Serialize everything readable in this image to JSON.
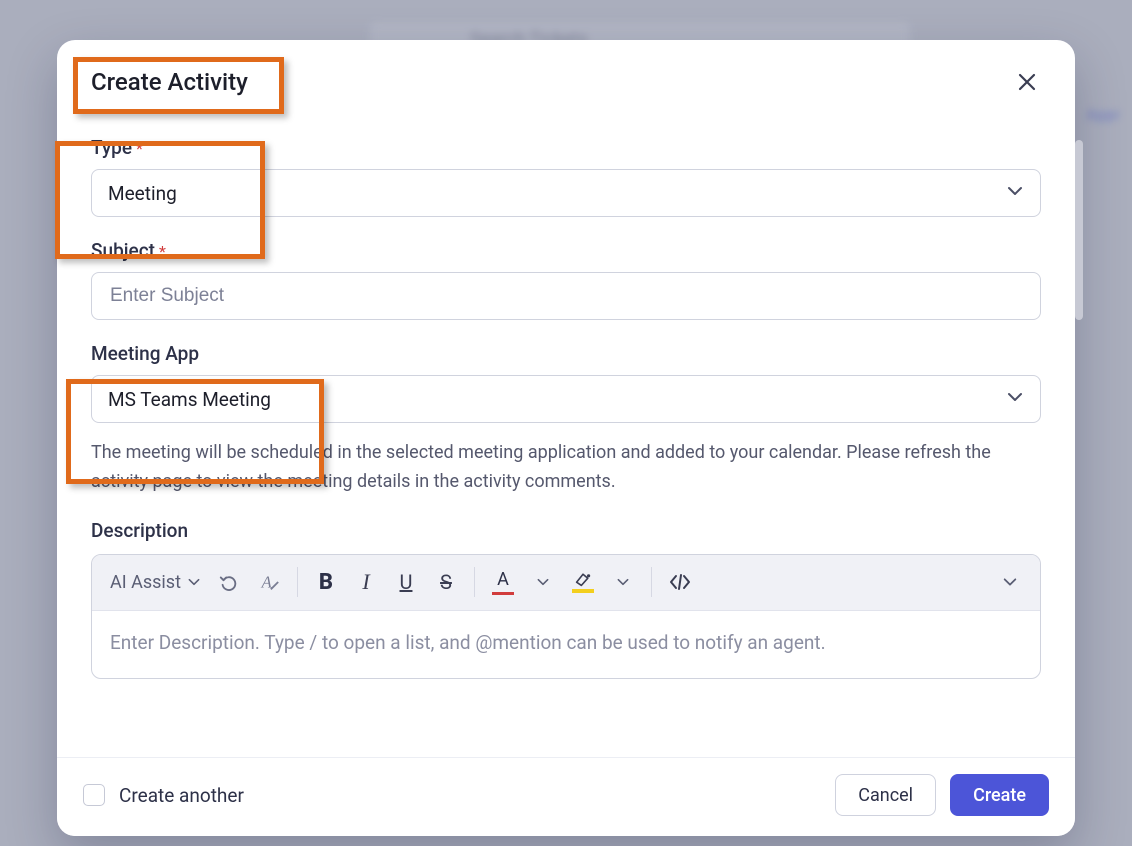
{
  "background": {
    "search_placeholder": "Search Tickets",
    "right_link": "Appr"
  },
  "modal": {
    "title": "Create Activity",
    "fields": {
      "type": {
        "label": "Type",
        "required": true,
        "value": "Meeting"
      },
      "subject": {
        "label": "Subject",
        "required": true,
        "placeholder": "Enter Subject",
        "value": ""
      },
      "meeting_app": {
        "label": "Meeting App",
        "required": false,
        "value": "MS Teams Meeting",
        "helper": "The meeting will be scheduled in the selected meeting application and added to your calendar. Please refresh the activity page to view the meeting details in the activity comments."
      },
      "description": {
        "label": "Description",
        "placeholder": "Enter Description. Type / to open a list, and @mention can be used to notify an agent."
      }
    },
    "toolbar": {
      "ai_assist": "AI Assist"
    },
    "footer": {
      "create_another": "Create another",
      "cancel": "Cancel",
      "create": "Create"
    }
  }
}
